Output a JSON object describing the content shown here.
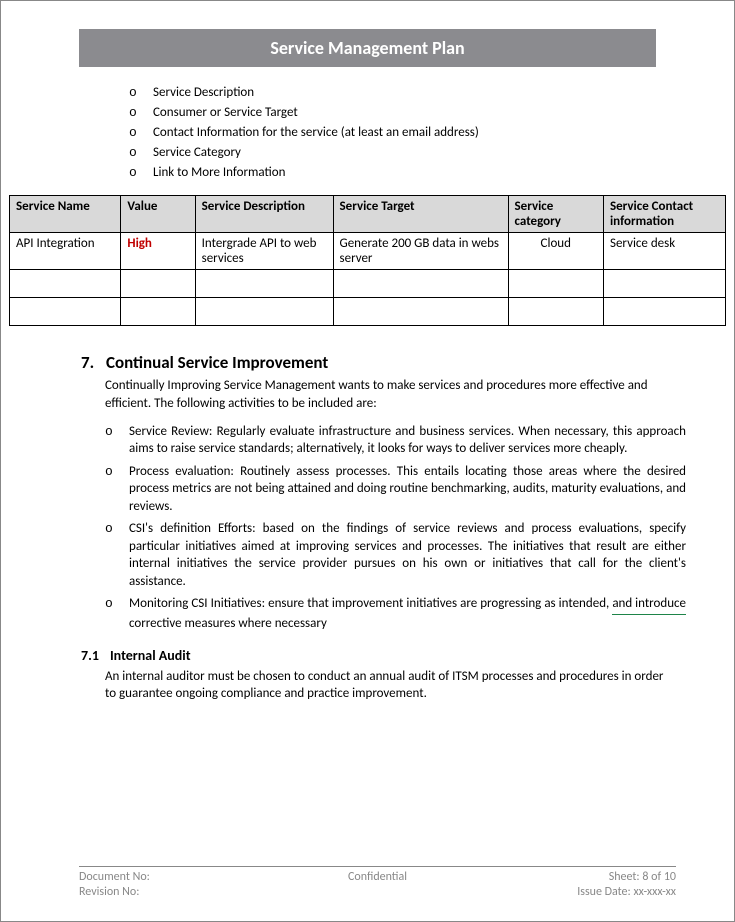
{
  "header": {
    "title": "Service Management Plan"
  },
  "topList": [
    "Service Description",
    "Consumer or Service Target",
    "Contact Information for the service (at least an email address)",
    "Service Category",
    "Link to More Information"
  ],
  "table": {
    "headers": [
      "Service Name",
      "Value",
      "Service Description",
      "Service Target",
      "Service category",
      "Service Contact information"
    ],
    "rows": [
      {
        "serviceName": "API Integration",
        "value": "High",
        "description": "Intergrade API to web services",
        "target": "Generate 200 GB data in webs server",
        "category": "Cloud",
        "contact": "Service desk"
      }
    ]
  },
  "section7": {
    "number": "7.",
    "title": "Continual Service Improvement",
    "intro": "Continually Improving Service Management wants to make services and procedures more effective and efficient. The following activities to be included are:",
    "bullets": [
      "Service Review: Regularly evaluate infrastructure and business services. When necessary, this approach aims to raise service standards; alternatively, it looks for ways to deliver services more cheaply.",
      "Process evaluation: Routinely assess processes. This entails locating those areas where the desired process metrics are not being attained and doing routine benchmarking, audits, maturity evaluations, and reviews.",
      "CSI's definition Efforts: based on the findings of service reviews and process evaluations, specify particular initiatives aimed at improving services and processes. The initiatives that result are either internal initiatives the service provider pursues on his own or initiatives that call for the client's assistance."
    ],
    "lastBullet": {
      "prefix": " Monitoring CSI Initiatives: ensure that improvement initiatives are progressing as intended, ",
      "underlined": "and  introduce",
      "suffix": " corrective measures where necessary"
    }
  },
  "section71": {
    "number": "7.1",
    "title": "Internal Audit",
    "body": "An internal auditor must be chosen to conduct an annual audit of ITSM processes and procedures in order to guarantee ongoing compliance and practice improvement."
  },
  "footer": {
    "docNo": "Document No:",
    "confidential": "Confidential",
    "sheet": "Sheet: 8 of 10",
    "revNo": "Revision No:",
    "issueDate": "Issue Date: xx-xxx-xx"
  }
}
